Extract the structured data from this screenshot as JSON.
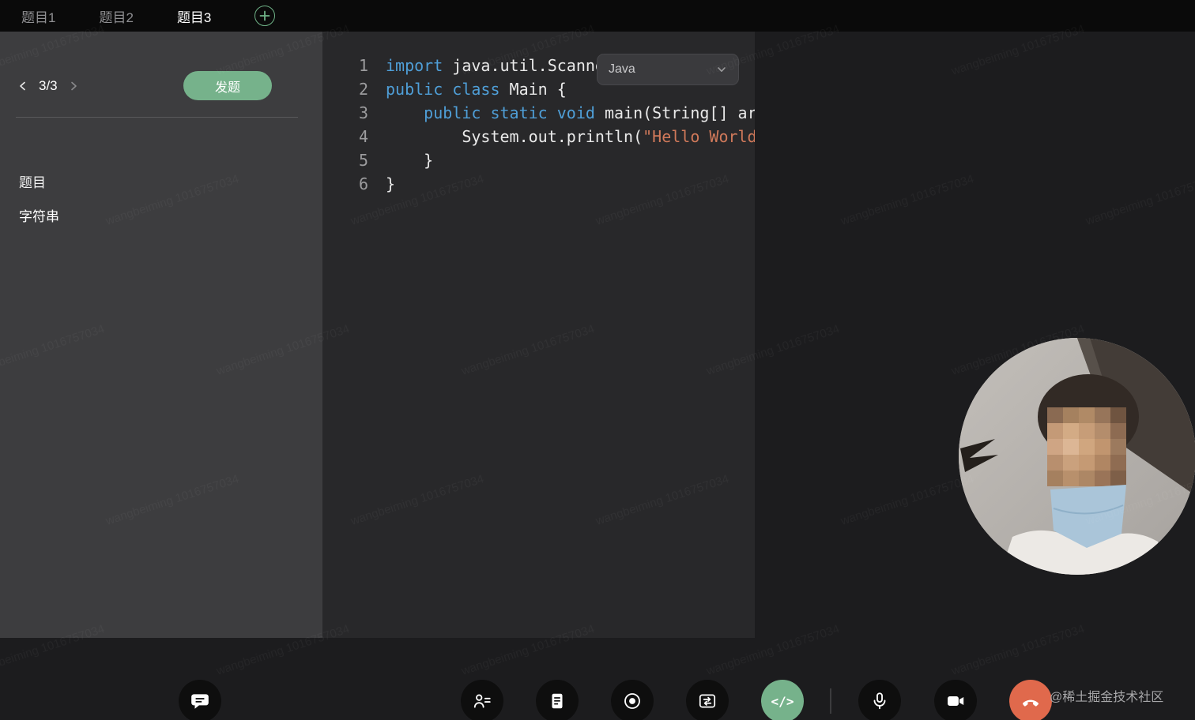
{
  "top_bar": {
    "tabs": [
      {
        "label": "题目1",
        "active": false
      },
      {
        "label": "题目2",
        "active": false
      },
      {
        "label": "题目3",
        "active": true
      }
    ]
  },
  "sidebar": {
    "pager_current": "3/3",
    "send_button_label": "发题",
    "section_label": "题目",
    "question_title": "字符串"
  },
  "editor": {
    "language": "Java",
    "code_lines": [
      {
        "num": "1",
        "tokens": [
          [
            "kw",
            "import"
          ],
          [
            "pl",
            " java.util.Scanner;"
          ]
        ]
      },
      {
        "num": "2",
        "tokens": [
          [
            "kw",
            "public"
          ],
          [
            "pl",
            " "
          ],
          [
            "kw",
            "class"
          ],
          [
            "pl",
            " Main {"
          ]
        ]
      },
      {
        "num": "3",
        "tokens": [
          [
            "pl",
            "    "
          ],
          [
            "kw",
            "public"
          ],
          [
            "pl",
            " "
          ],
          [
            "kw",
            "static"
          ],
          [
            "pl",
            " "
          ],
          [
            "kw",
            "void"
          ],
          [
            "pl",
            " main(String[] args) {"
          ]
        ]
      },
      {
        "num": "4",
        "tokens": [
          [
            "pl",
            "        System.out.println("
          ],
          [
            "str",
            "\"Hello World\""
          ],
          [
            "pl",
            ");"
          ]
        ]
      },
      {
        "num": "5",
        "tokens": [
          [
            "pl",
            "    }"
          ]
        ]
      },
      {
        "num": "6",
        "tokens": [
          [
            "pl",
            "}"
          ]
        ]
      }
    ]
  },
  "toolbar": {
    "code_glyph": "</>",
    "icons": [
      "chat-icon",
      "participants-icon",
      "notes-icon",
      "record-icon",
      "switch-icon",
      "code-icon",
      "mic-icon",
      "camera-icon",
      "phone-hangup-icon"
    ]
  },
  "watermark": {
    "diagonal_text": "wangbeiming 1016757034",
    "credit_text": "@稀土掘金技术社区"
  },
  "colors": {
    "accent_green": "#76b28b",
    "hangup_orange": "#e0694c",
    "keyword_blue": "#4f9fd8",
    "string_orange": "#d0795a"
  }
}
